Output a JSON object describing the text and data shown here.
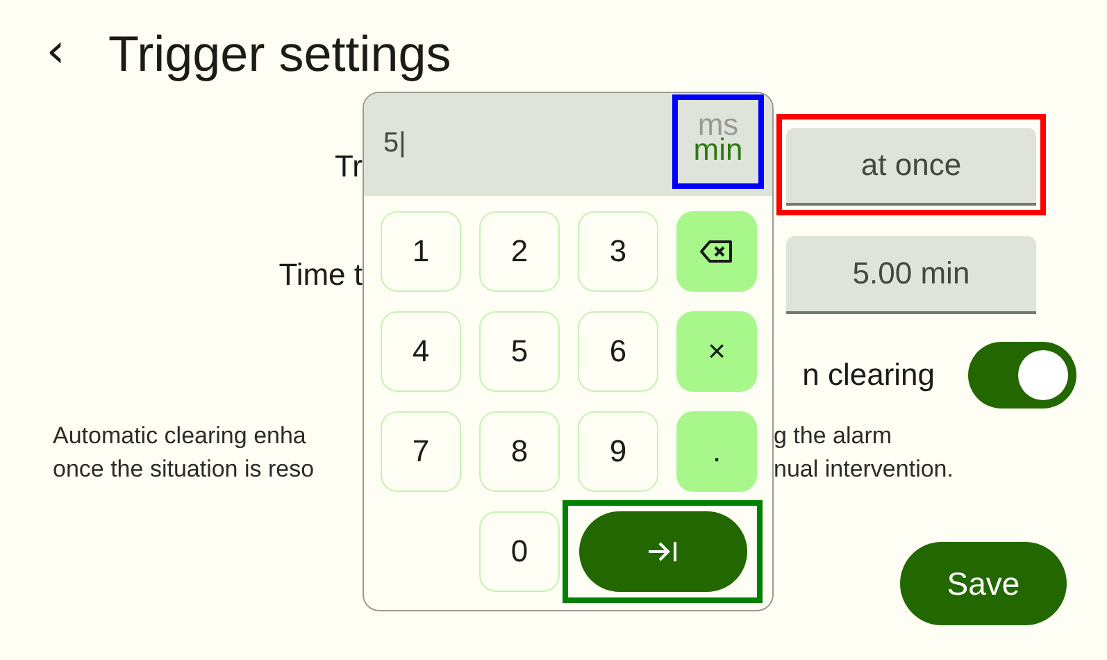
{
  "header": {
    "back": "‹",
    "title": "Trigger settings"
  },
  "rows": [
    {
      "kind": "field",
      "label": "Tr",
      "value": "at once",
      "color": "#ff0000"
    },
    {
      "kind": "field",
      "label": "Time t",
      "value": "5.00 min"
    },
    {
      "kind": "switch",
      "label": "n clearing",
      "on": true
    }
  ],
  "description": [
    {
      "left": "Automatic clearing enha",
      "right": "g the alarm"
    },
    {
      "left": "once the situation is reso",
      "right": "nual intervention."
    }
  ],
  "save_button": "Save",
  "keypad": {
    "input": "5|",
    "unit_picker": {
      "color": "#0000ff",
      "units": [
        {
          "label": "ms",
          "selected": false
        },
        {
          "label": "min",
          "selected": true
        }
      ]
    },
    "keys": [
      {
        "kind": "digit",
        "label": "1"
      },
      {
        "kind": "digit",
        "label": "2"
      },
      {
        "kind": "digit",
        "label": "3"
      },
      {
        "kind": "backspace"
      },
      {
        "kind": "digit",
        "label": "4"
      },
      {
        "kind": "digit",
        "label": "5"
      },
      {
        "kind": "digit",
        "label": "6"
      },
      {
        "kind": "action",
        "label": "×"
      },
      {
        "kind": "digit",
        "label": "7"
      },
      {
        "kind": "digit",
        "label": "8"
      },
      {
        "kind": "digit",
        "label": "9"
      },
      {
        "kind": "action",
        "label": "."
      },
      {
        "kind": "blank"
      },
      {
        "kind": "digit",
        "label": "0"
      },
      {
        "kind": "enter",
        "color": "#008000"
      }
    ]
  }
}
